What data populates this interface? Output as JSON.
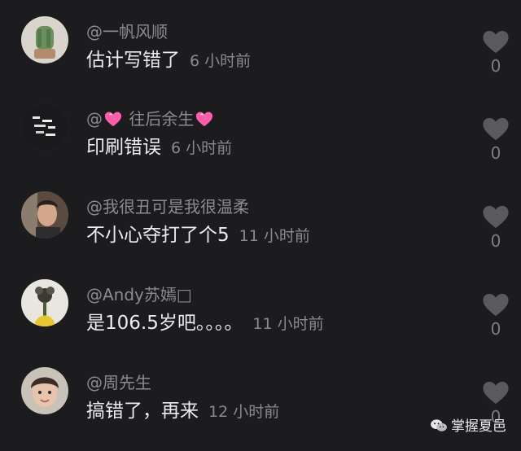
{
  "comments": [
    {
      "username": "@一帆风顺",
      "text": "估计写错了",
      "time": "6 小时前",
      "likes": "0",
      "avatar_icon": "avatar-cactus-icon"
    },
    {
      "username_prefix": "@",
      "username_name": "往后余生",
      "text": "印刷错误",
      "time": "6 小时前",
      "likes": "0",
      "avatar_icon": "avatar-night-lights-icon",
      "emoji_icon": "pink-heart-emoji-icon"
    },
    {
      "username": "@我很丑可是我很温柔",
      "text": "不小心夺打了个5",
      "time": "11 小时前",
      "likes": "0",
      "avatar_icon": "avatar-man-portrait-icon"
    },
    {
      "username": "@Andy苏嫣□",
      "text": "是106.5岁吧。。。。",
      "time": "11 小时前",
      "likes": "0",
      "avatar_icon": "avatar-flower-icon"
    },
    {
      "username": "@周先生",
      "text": "搞错了，再来",
      "time": "12 小时前",
      "likes": "0",
      "avatar_icon": "avatar-child-portrait-icon"
    }
  ],
  "watermark": {
    "text": "掌握夏邑",
    "icon": "wechat-icon"
  },
  "colors": {
    "background": "#1c1c1e",
    "username": "#8c8c8f",
    "comment_text": "#ececee",
    "timestamp": "#8a8a8d",
    "like_heart": "#5a5a5d",
    "emoji_heart": "#ff5fa8"
  }
}
